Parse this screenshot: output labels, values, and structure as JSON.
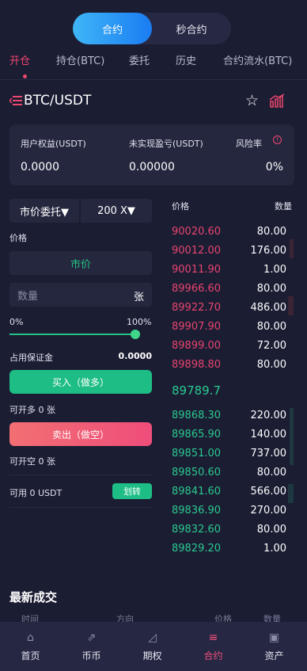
{
  "mode_toggle": {
    "contract": "合约",
    "second_contract": "秒合约"
  },
  "tabs": [
    "开仓",
    "持仓(BTC)",
    "委托",
    "历史",
    "合约流水(BTC)"
  ],
  "pair": "BTC/USDT",
  "equity": {
    "user_equity_label": "用户权益(USDT)",
    "user_equity_value": "0.0000",
    "unrealized_label": "未实现盈亏(USDT)",
    "unrealized_value": "0.00000",
    "risk_label": "风险率",
    "risk_value": "0%"
  },
  "trade": {
    "order_type": "市价委托▼",
    "leverage": "200 X▼",
    "price_label": "价格",
    "price_value": "市价",
    "qty_placeholder": "数量",
    "qty_unit": "张",
    "slider_min": "0%",
    "slider_max": "100%",
    "slider_value": 1.0,
    "margin_label": "占用保证金",
    "margin_value": "0.0000",
    "buy_label": "买入（做多）",
    "can_long": "可开多 0 张",
    "sell_label": "卖出（做空）",
    "can_short": "可开空 0 张",
    "available": "可用 0 USDT",
    "transfer": "划转"
  },
  "orderbook": {
    "price_header": "价格",
    "qty_header": "数量",
    "asks": [
      {
        "price": "90020.60",
        "qty": "80.00"
      },
      {
        "price": "90012.00",
        "qty": "176.00"
      },
      {
        "price": "90011.90",
        "qty": "1.00"
      },
      {
        "price": "89966.60",
        "qty": "80.00"
      },
      {
        "price": "89922.70",
        "qty": "486.00"
      },
      {
        "price": "89907.90",
        "qty": "80.00"
      },
      {
        "price": "89899.00",
        "qty": "72.00"
      },
      {
        "price": "89898.80",
        "qty": "80.00"
      }
    ],
    "last_price": "89789.7",
    "bids": [
      {
        "price": "89868.30",
        "qty": "220.00"
      },
      {
        "price": "89865.90",
        "qty": "140.00"
      },
      {
        "price": "89851.00",
        "qty": "737.00"
      },
      {
        "price": "89850.60",
        "qty": "80.00"
      },
      {
        "price": "89841.60",
        "qty": "566.00"
      },
      {
        "price": "89836.90",
        "qty": "270.00"
      },
      {
        "price": "89832.60",
        "qty": "80.00"
      },
      {
        "price": "89829.20",
        "qty": "1.00"
      }
    ]
  },
  "latest_trades": {
    "title": "最新成交",
    "headers": [
      "时间",
      "方向",
      "价格",
      "数量"
    ]
  },
  "nav": [
    {
      "label": "首页",
      "icon": "home-icon"
    },
    {
      "label": "币币",
      "icon": "coin-trade-icon"
    },
    {
      "label": "期权",
      "icon": "options-icon"
    },
    {
      "label": "合约",
      "icon": "contract-icon"
    },
    {
      "label": "资产",
      "icon": "wallet-icon"
    }
  ],
  "colors": {
    "accent": "#f0476e",
    "up": "#2ac98f",
    "down": "#e8456f",
    "blue": "#1a7cf2"
  }
}
